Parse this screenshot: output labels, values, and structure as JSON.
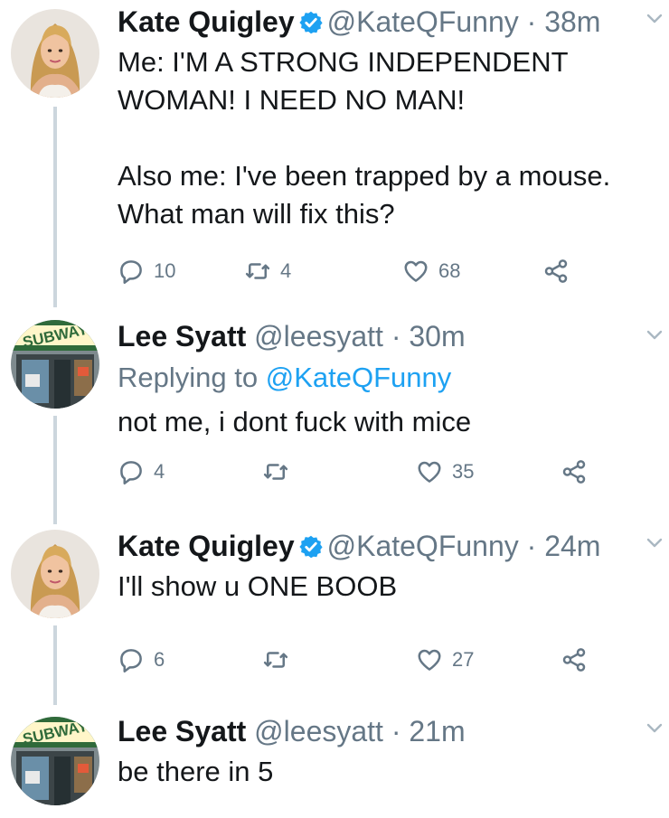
{
  "tweets": [
    {
      "name": "Kate Quigley",
      "handle": "@KateQFunny",
      "dot": "·",
      "time": "38m",
      "text": "Me:  I'M A STRONG INDEPENDENT WOMAN! I NEED NO MAN!\n\nAlso me: I've been trapped by a mouse. What man will fix this?",
      "replies": "10",
      "retweets": "4",
      "likes": "68",
      "verified": true
    },
    {
      "name": "Lee Syatt",
      "handle": "@leesyatt",
      "dot": "·",
      "time": "30m",
      "replying_label": "Replying to",
      "replying_handle": "@KateQFunny",
      "text": "not me, i dont fuck with mice",
      "replies": "4",
      "retweets": "",
      "likes": "35",
      "avatar_sign": "SUBWAY"
    },
    {
      "name": "Kate Quigley",
      "handle": "@KateQFunny",
      "dot": "·",
      "time": "24m",
      "text": "I'll show u ONE BOOB",
      "replies": "6",
      "retweets": "",
      "likes": "27",
      "verified": true
    },
    {
      "name": "Lee Syatt",
      "handle": "@leesyatt",
      "dot": "·",
      "time": "21m",
      "text": "be there in 5",
      "avatar_sign": "SUBWAY"
    }
  ],
  "colors": {
    "text": "#14171a",
    "muted": "#657786",
    "link": "#1da1f2",
    "thread": "#ccd6dd"
  },
  "icons": [
    "verified-badge-icon",
    "chevron-down-icon",
    "reply-icon",
    "retweet-icon",
    "like-icon",
    "share-icon"
  ]
}
